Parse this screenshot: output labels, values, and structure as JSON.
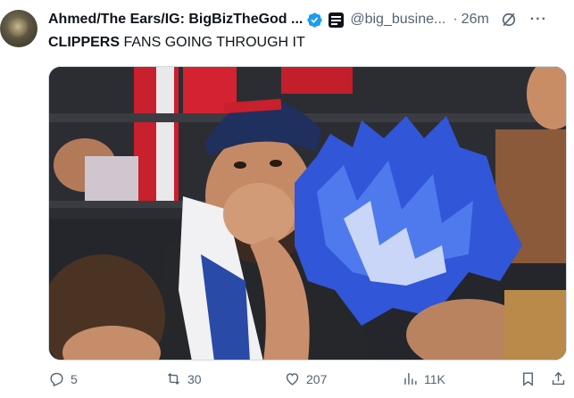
{
  "tweet": {
    "display_name": "Ahmed/The Ears/IG: BigBizTheGod ...",
    "handle": "@big_busine...",
    "separator": "·",
    "time": "26m",
    "text_bold": "CLIPPERS",
    "text_rest": " FANS GOING THROUGH IT",
    "verified_color": "#1d9bf0"
  },
  "media": {
    "icon": "photo-of-clippers-fans"
  },
  "actions": {
    "replies": "5",
    "reposts": "30",
    "likes": "207",
    "views": "11K"
  }
}
